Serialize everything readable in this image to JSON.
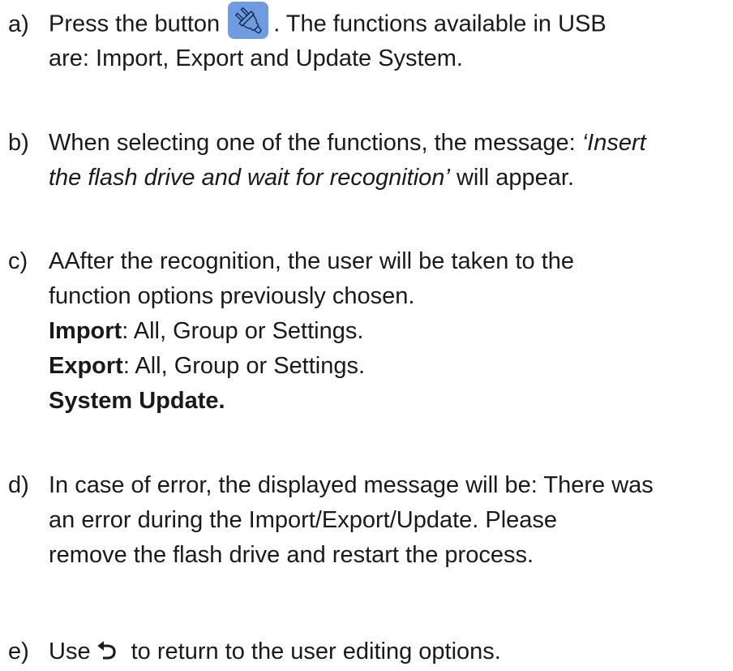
{
  "items": {
    "a": {
      "marker": "a)",
      "text_before": "Press the button",
      "icon": "usb-icon",
      "text_after": ". The functions available in USB",
      "line2": "are: Import, Export and Update System."
    },
    "b": {
      "marker": "b)",
      "line1_plain": "When selecting one of the functions, the message:",
      "line1_italic": "‘Insert",
      "line2_italic": "the flash drive and wait for recognition’",
      "line2_plain": " will appear."
    },
    "c": {
      "marker": "c)",
      "line1": "AAfter the recognition, the user will be taken to the",
      "line2": "function options previously chosen.",
      "import_label": "Import",
      "import_text": ": All, Group or Settings.",
      "export_label": "Export",
      "export_text": ": All, Group or Settings.",
      "system_update": "System Update."
    },
    "d": {
      "marker": "d)",
      "line1": "In case of error, the displayed message will be: There was",
      "line2": "an error during the Import/Export/Update. Please",
      "line3": "remove the flash drive and restart the process."
    },
    "e": {
      "marker": "e)",
      "text_before": "Use",
      "icon": "return-arrow-icon",
      "icon_glyph": "⮌",
      "text_after": "to return to the user editing options."
    }
  },
  "usb_button_color": "#6f9be0"
}
